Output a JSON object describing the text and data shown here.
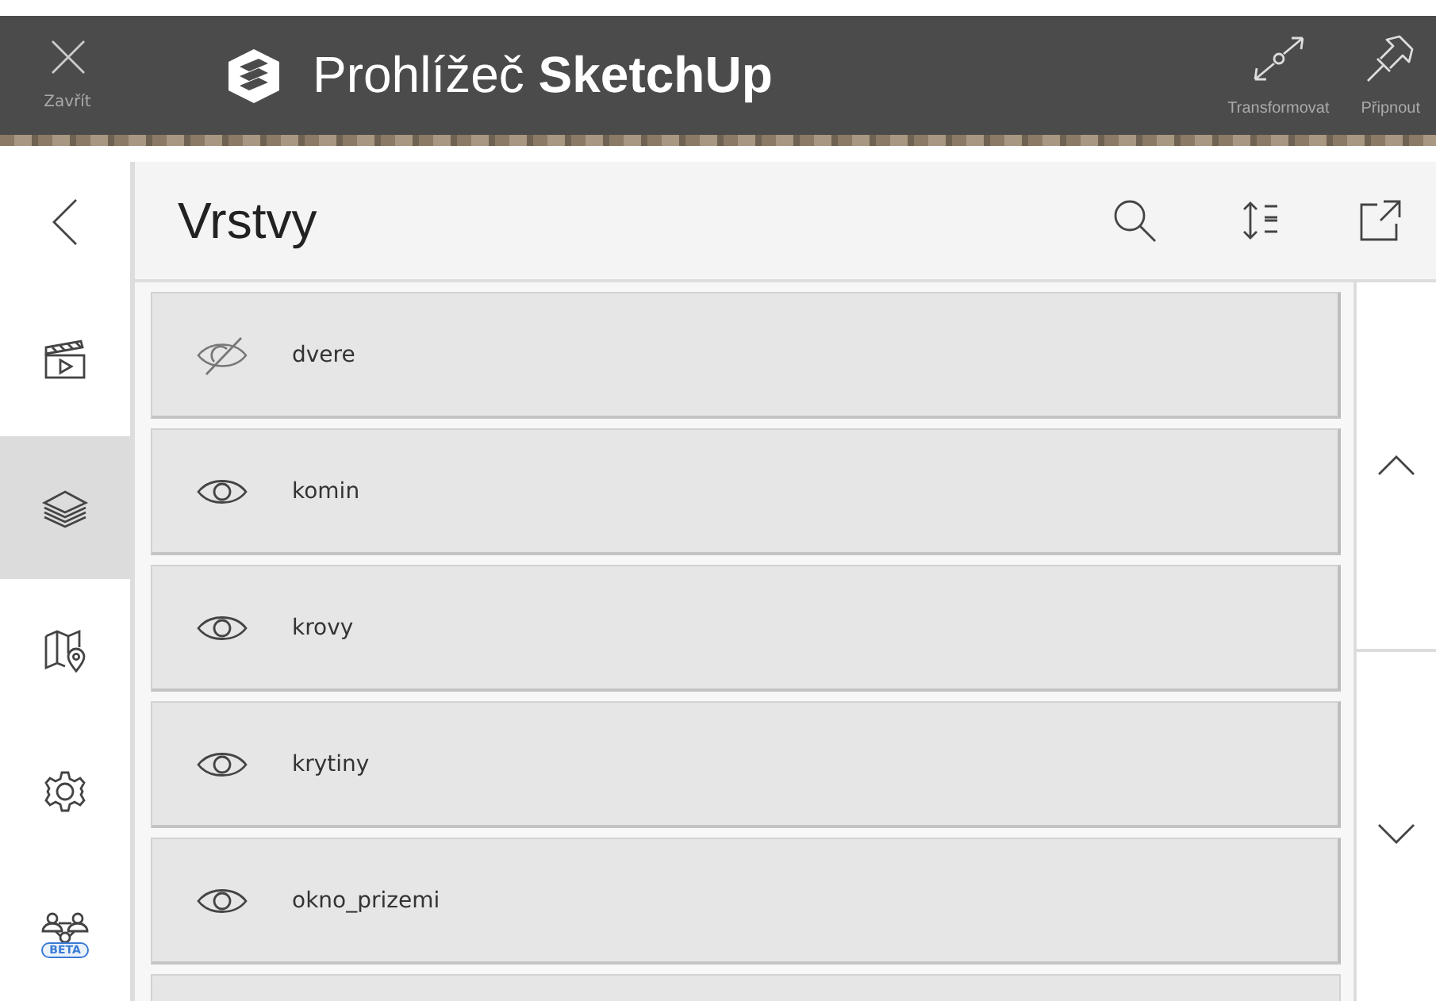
{
  "top_bar": {
    "close_label": "Zavřít",
    "title": "Prohlížeč **SketchUp**",
    "actions": [
      {
        "label": "Transformovat"
      },
      {
        "label": "Připnout"
      }
    ]
  },
  "sidebar": {
    "items": [
      {
        "selected": false
      },
      {
        "selected": true
      },
      {
        "selected": false
      },
      {
        "selected": false
      },
      {
        "selected": false,
        "badge": "BETA"
      }
    ]
  },
  "panel": {
    "title": "Vrstvy"
  },
  "layers": [
    {
      "name": "dvere",
      "visible": false
    },
    {
      "name": "komin",
      "visible": true
    },
    {
      "name": "krovy",
      "visible": true
    },
    {
      "name": "krytiny",
      "visible": true
    },
    {
      "name": "okno_prizemi",
      "visible": true
    }
  ]
}
